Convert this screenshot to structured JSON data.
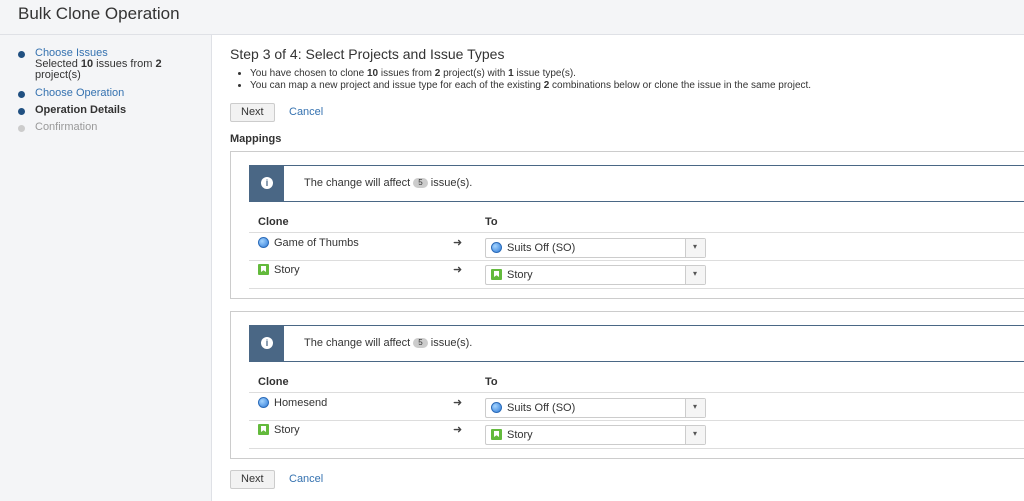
{
  "page": {
    "title": "Bulk Clone Operation"
  },
  "sidebar": {
    "step1": {
      "label": "Choose Issues",
      "sub_a": "Selected ",
      "sub_count": "10",
      "sub_b": " issues from ",
      "sub_projects": "2",
      "sub_c": " project(s)"
    },
    "step2": {
      "label": "Choose Operation"
    },
    "step3": {
      "label": "Operation Details"
    },
    "step4": {
      "label": "Confirmation"
    }
  },
  "main": {
    "title": "Step 3 of 4: Select Projects and Issue Types",
    "bullet1": {
      "a": "You have chosen to clone ",
      "issues": "10",
      "b": " issues from ",
      "projects": "2",
      "c": " project(s) with ",
      "types": "1",
      "d": " issue type(s)."
    },
    "bullet2": {
      "a": "You can map a new project and issue type for each of the existing ",
      "count": "2",
      "b": " combinations below or clone the issue in the same project."
    },
    "next_label": "Next",
    "cancel_label": "Cancel",
    "mappings_heading": "Mappings"
  },
  "mappings": [
    {
      "info": {
        "a": "The change will affect",
        "count": "5",
        "b": "issue(s)."
      },
      "clone_header": "Clone",
      "to_header": "To",
      "project_from": "Game of Thumbs",
      "project_to": "Suits Off (SO)",
      "type_from": "Story",
      "type_to": "Story",
      "arrow": "➜"
    },
    {
      "info": {
        "a": "The change will affect",
        "count": "5",
        "b": "issue(s)."
      },
      "clone_header": "Clone",
      "to_header": "To",
      "project_from": "Homesend",
      "project_to": "Suits Off (SO)",
      "type_from": "Story",
      "type_to": "Story",
      "arrow": "➜"
    }
  ],
  "colors": {
    "accent": "#3572b0",
    "info_bar": "#4a6785",
    "step_dot": "#205081",
    "story": "#63ba3c"
  },
  "icons": {
    "info": "info-icon",
    "project": "project-avatar-icon",
    "story": "story-icon",
    "arrow": "arrow-right-icon",
    "dropdown": "chevron-down-icon"
  }
}
